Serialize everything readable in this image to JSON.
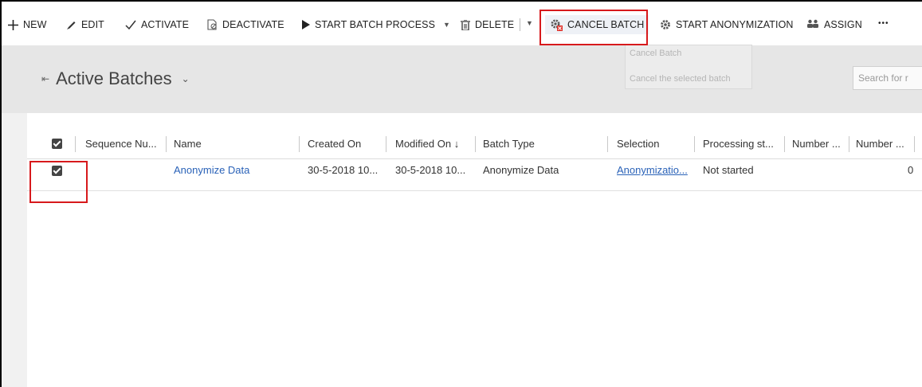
{
  "toolbar": {
    "new": "NEW",
    "edit": "EDIT",
    "activate": "ACTIVATE",
    "deactivate": "DEACTIVATE",
    "start_batch_process": "START BATCH PROCESS",
    "delete": "DELETE",
    "cancel_batch": "CANCEL BATCH",
    "start_anonymization": "START ANONYMIZATION",
    "assign": "ASSIGN",
    "more": "•••"
  },
  "tooltip": {
    "title": "Cancel Batch",
    "description": "Cancel the selected batch"
  },
  "view": {
    "title": "Active Batches",
    "search_placeholder": "Search for r"
  },
  "grid": {
    "columns": [
      "Sequence Nu...",
      "Name",
      "Created On",
      "Modified On ↓",
      "Batch Type",
      "Selection",
      "Processing st...",
      "Number ...",
      "Number ..."
    ],
    "rows": [
      {
        "sequence": "",
        "name": "Anonymize Data",
        "created_on": "30-5-2018 10...",
        "modified_on": "30-5-2018 10...",
        "batch_type": "Anonymize Data",
        "selection": "Anonymizatio...",
        "processing_status": "Not started",
        "number": "0"
      }
    ]
  },
  "colors": {
    "highlight_border": "#d7191c",
    "link": "#2a62b8",
    "cancel_icon": "#e0322b"
  }
}
